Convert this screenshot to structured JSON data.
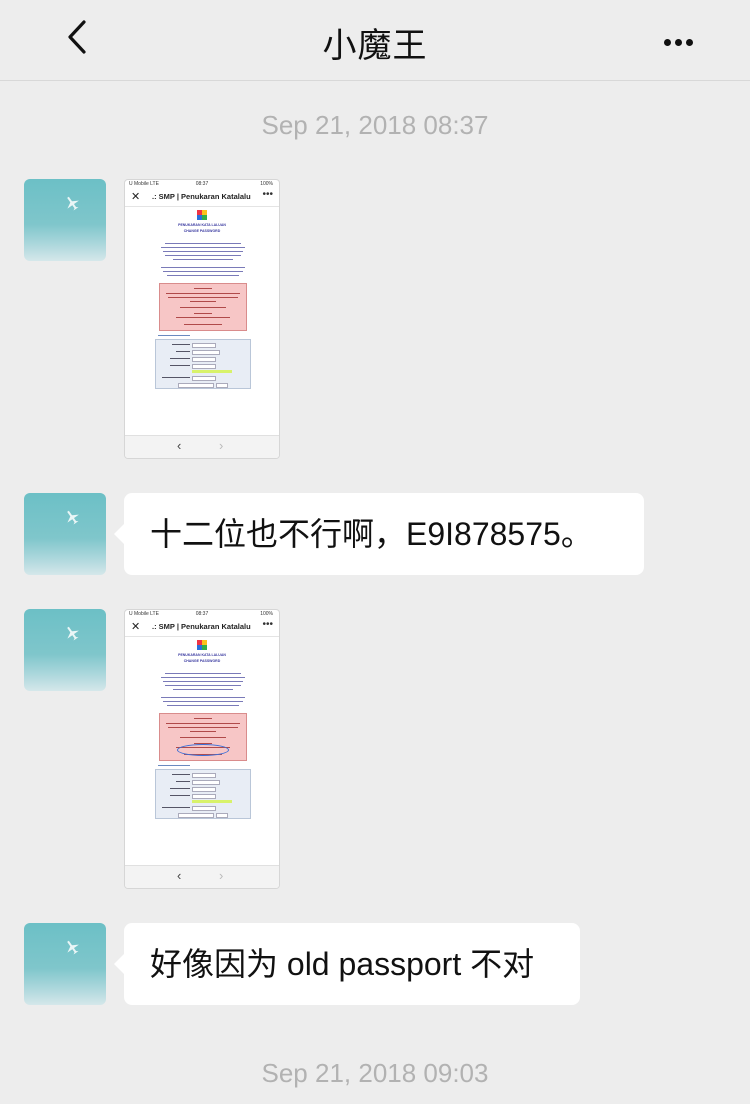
{
  "header": {
    "title": "小魔王"
  },
  "messages": {
    "time1": "Sep 21, 2018 08:37",
    "text1": "十二位也不行啊，E9I878575。",
    "text2": "好像因为 old passport 不对",
    "time2": "Sep 21, 2018 09:03"
  },
  "screenshot": {
    "carrier": "U Mobile  LTE",
    "clock": "08:37",
    "battery": "100%",
    "page_title": ".: SMP | Penukaran Katalalu",
    "close": "✕",
    "menu": "•••",
    "heading1": "PENUKARAN KATA LALUAN",
    "heading2": "CHANGE PASSWORD",
    "prev": "‹",
    "next": "›"
  },
  "colors": {
    "bubble": "#ffffff",
    "background": "#ededed",
    "timestamp": "#b2b2b2"
  }
}
